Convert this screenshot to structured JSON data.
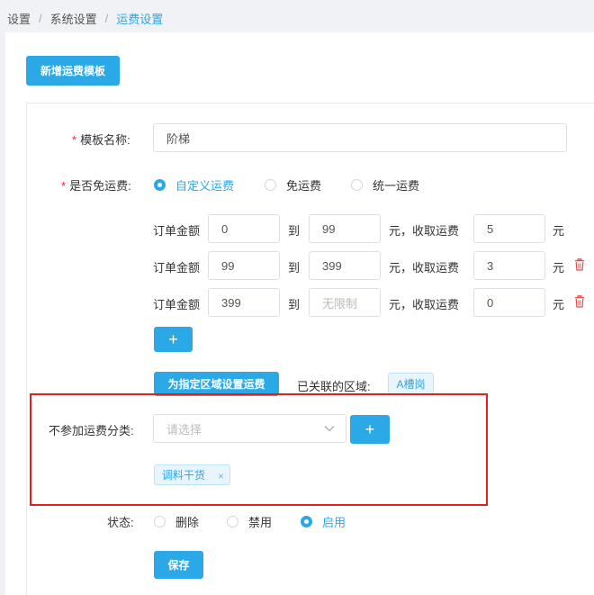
{
  "breadcrumb": {
    "item1": "设置",
    "item2": "系统设置",
    "item3": "运费设置",
    "sep": "/"
  },
  "toolbar": {
    "add_template": "新增运费模板"
  },
  "form": {
    "template_name_label": "模板名称:",
    "template_name_value": "阶梯",
    "free_shipping_label": "是否免运费:",
    "free_shipping_options": [
      "自定义运费",
      "免运费",
      "统一运费"
    ],
    "free_shipping_selected": "自定义运费",
    "tiers": [
      {
        "prefix": "订单金额",
        "from": "0",
        "to_label": "到",
        "to": "99",
        "to_placeholder": "",
        "charge_label": "元，收取运费",
        "fee": "5",
        "unit": "元",
        "deletable": false
      },
      {
        "prefix": "订单金额",
        "from": "99",
        "to_label": "到",
        "to": "399",
        "to_placeholder": "",
        "charge_label": "元，收取运费",
        "fee": "3",
        "unit": "元",
        "deletable": true
      },
      {
        "prefix": "订单金额",
        "from": "399",
        "to_label": "到",
        "to": "",
        "to_placeholder": "无限制",
        "charge_label": "元，收取运费",
        "fee": "0",
        "unit": "元",
        "deletable": true
      }
    ],
    "add_tier": "+",
    "region_button": "为指定区域设置运费",
    "linked_region_label": "已关联的区域:",
    "linked_region_tag": "A槽岗",
    "exclude_label": "不参加运费分类:",
    "exclude_placeholder": "请选择",
    "exclude_add": "+",
    "exclude_chip": "调料干货",
    "exclude_chip_close": "×",
    "status_label": "状态:",
    "status_options": [
      "删除",
      "禁用",
      "启用"
    ],
    "status_selected": "启用",
    "save": "保存"
  },
  "colors": {
    "accent": "#2ba8e6",
    "danger": "#e02020",
    "required": "#f5222d"
  },
  "icons": {
    "delete": "trash-icon",
    "dropdown": "chevron-down-icon"
  }
}
